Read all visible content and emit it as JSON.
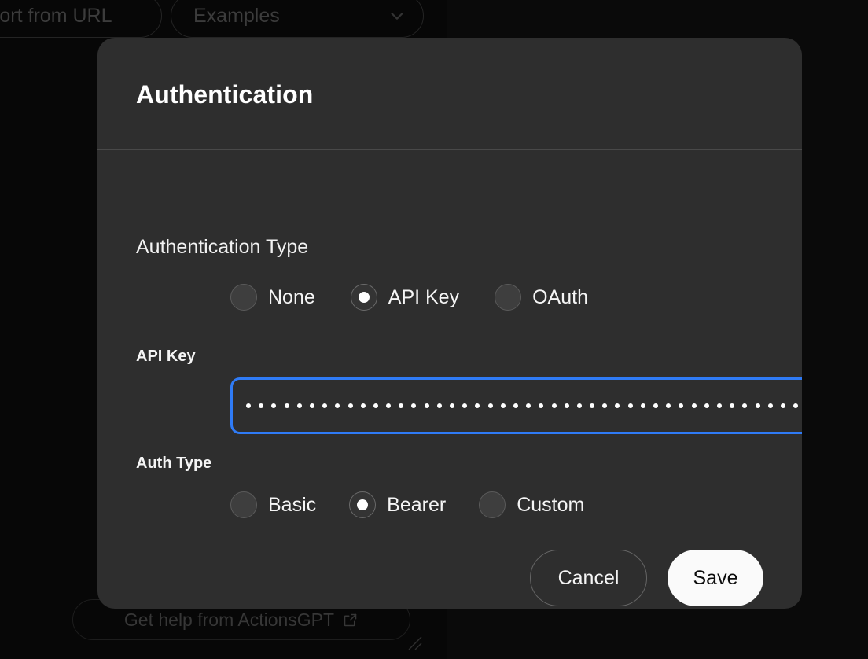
{
  "background": {
    "import_button": {
      "label": "port from URL"
    },
    "examples_dropdown": {
      "label": "Examples",
      "icon": "chevron-down-icon"
    },
    "actions_gpt_button": {
      "label": "Get help from ActionsGPT",
      "icon": "external-link-icon"
    }
  },
  "modal": {
    "title": "Authentication",
    "auth_type": {
      "label": "Authentication Type",
      "selected": "API Key",
      "options": [
        {
          "label": "None",
          "selected": false
        },
        {
          "label": "API Key",
          "selected": true
        },
        {
          "label": "OAuth",
          "selected": false
        }
      ]
    },
    "api_key": {
      "label": "API Key",
      "value": "••••••••••••••••••••••••••••••••••••••••••••••••••",
      "masked_char_count": 50,
      "focused": true,
      "focus_color": "#2f7bf6",
      "placeholder": ""
    },
    "auth_subtype": {
      "label": "Auth Type",
      "selected": "Bearer",
      "options": [
        {
          "label": "Basic",
          "selected": false
        },
        {
          "label": "Bearer",
          "selected": true
        },
        {
          "label": "Custom",
          "selected": false
        }
      ]
    },
    "footer": {
      "cancel_label": "Cancel",
      "save_label": "Save"
    }
  }
}
